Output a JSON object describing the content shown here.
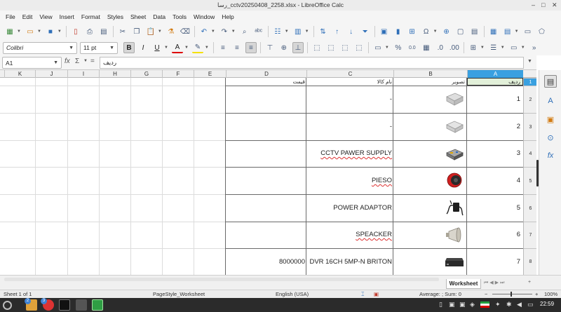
{
  "window": {
    "title": "رسا_cctv20250408_2258.xlsx - LibreOffice Calc",
    "min": "–",
    "max": "□",
    "close": "✕"
  },
  "menu": [
    "File",
    "Edit",
    "View",
    "Insert",
    "Format",
    "Styles",
    "Sheet",
    "Data",
    "Tools",
    "Window",
    "Help"
  ],
  "toolbar2": {
    "font_name": "Colibri",
    "font_size": "11 pt",
    "bold": "B",
    "italic": "I",
    "underline": "U",
    "percent": "%",
    "decimals": "0.0",
    "more": "»"
  },
  "formula": {
    "name_box": "A1",
    "fx": "fx",
    "sigma": "Σ",
    "equals": "=",
    "content": "ردیف"
  },
  "columns": [
    "K",
    "J",
    "I",
    "H",
    "G",
    "F",
    "E",
    "D",
    "C",
    "B",
    "A"
  ],
  "rows": [
    {
      "num": "1",
      "A": "ردیف",
      "B": "تصویر",
      "C": "نام کالا",
      "D": "قیمت"
    },
    {
      "num": "2",
      "A": "1",
      "B": "",
      "C": "-",
      "D": ""
    },
    {
      "num": "3",
      "A": "2",
      "B": "",
      "C": "-",
      "D": ""
    },
    {
      "num": "4",
      "A": "3",
      "B": "",
      "C": "CCTV PAWER SUPPLY",
      "D": ""
    },
    {
      "num": "5",
      "A": "4",
      "B": "",
      "C": "PIESO",
      "D": ""
    },
    {
      "num": "6",
      "A": "5",
      "B": "",
      "C": "POWER ADAPTOR",
      "D": ""
    },
    {
      "num": "7",
      "A": "6",
      "B": "",
      "C": "SPEACKER",
      "D": ""
    },
    {
      "num": "8",
      "A": "7",
      "B": "",
      "C": "DVR 16CH 5MP-N BRITON",
      "D": "8000000"
    }
  ],
  "sheet_tab": "Worksheet",
  "status": {
    "sheet": "Sheet 1 of 1",
    "page_style": "PageStyle_Worksheet",
    "language": "English (USA)",
    "sum": "Average: ; Sum: 0",
    "zoom": "100%"
  },
  "taskbar": {
    "clock": "22:59",
    "badge1": "2",
    "badge2": "3"
  },
  "colors": {
    "selection": "#39a0e0",
    "header_fill": "#efefef",
    "a1_fill": "#e2f0d9"
  }
}
